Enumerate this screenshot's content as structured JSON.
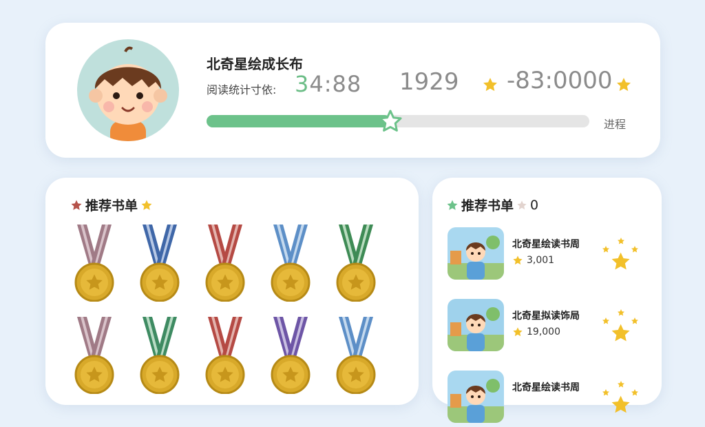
{
  "profile": {
    "name": "北奇星绘成长布",
    "stat_label": "阅读统计寸依:",
    "stat_value_highlight": "3",
    "stat_value_rest": "4:88",
    "number": "1929",
    "range": "-83:0000",
    "progress_label": "进程",
    "progress_percent": 48
  },
  "medals_section": {
    "title": "推荐书单",
    "medals": [
      {
        "ribbon": "#a07a86",
        "stripe": "#d9c3ca"
      },
      {
        "ribbon": "#3f67a8",
        "stripe": "#b7c8e5"
      },
      {
        "ribbon": "#b54a44",
        "stripe": "#e3b3ad"
      },
      {
        "ribbon": "#5d8fc7",
        "stripe": "#c4d9ee"
      },
      {
        "ribbon": "#3e8b55",
        "stripe": "#b9dcbf"
      },
      {
        "ribbon": "#a07a86",
        "stripe": "#d9c3ca"
      },
      {
        "ribbon": "#3e8b62",
        "stripe": "#b9dcc5"
      },
      {
        "ribbon": "#b54a44",
        "stripe": "#e3b3ad"
      },
      {
        "ribbon": "#6d55a6",
        "stripe": "#c9bfe2"
      },
      {
        "ribbon": "#5d8fc7",
        "stripe": "#c4d9ee"
      }
    ]
  },
  "books_section": {
    "title": "推荐书单",
    "count": "0",
    "books": [
      {
        "title": "北奇星绘读书周",
        "count": "3,001",
        "bg": "#a9d8f0"
      },
      {
        "title": "北奇星拟读饰局",
        "count": "19,000",
        "bg": "#9fd2ec"
      },
      {
        "title": "北奇星绘读书周",
        "count": "",
        "bg": "#a9d8f0"
      }
    ]
  },
  "colors": {
    "accent": "#6cc28a",
    "star": "#f2c02a",
    "text_muted": "#8b8b8b"
  }
}
